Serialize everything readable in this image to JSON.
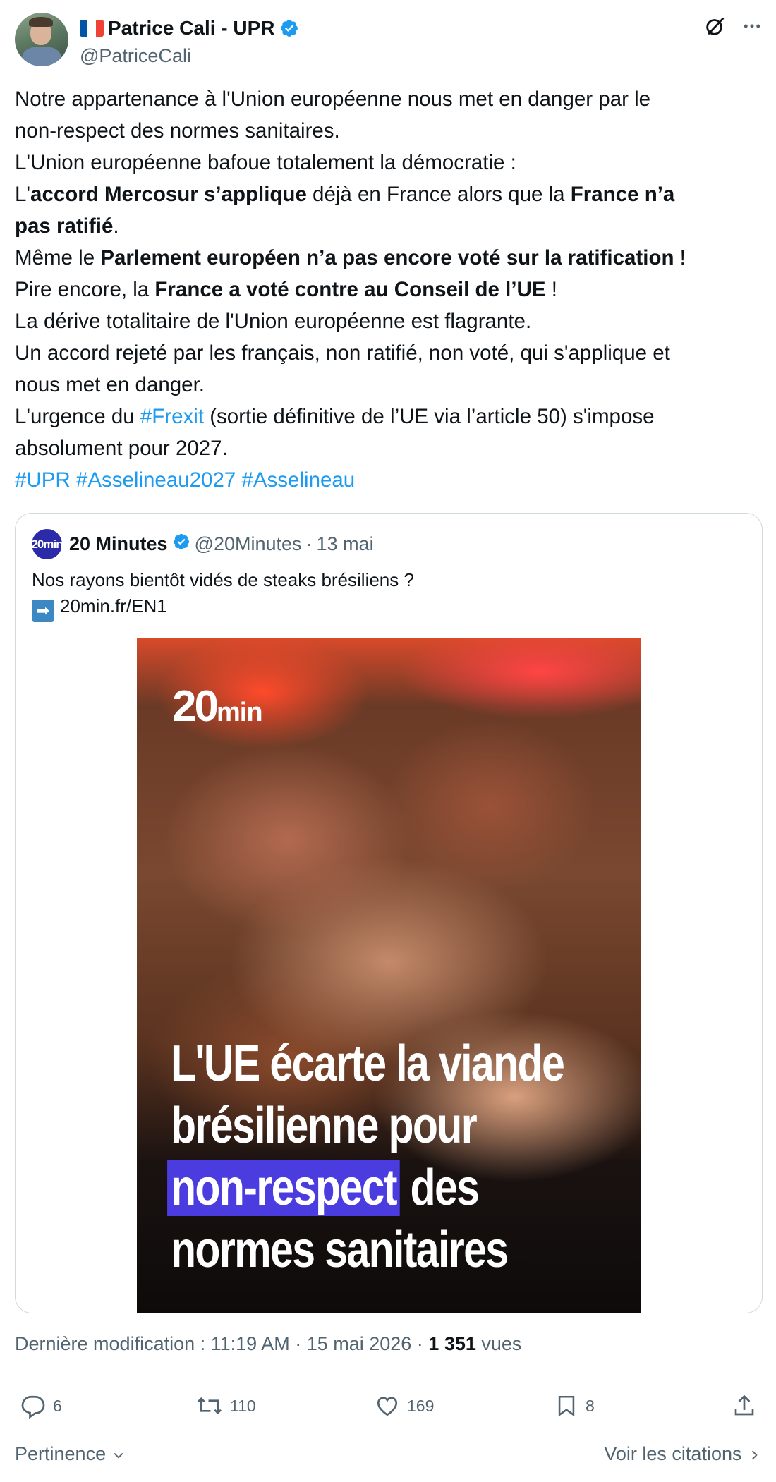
{
  "author": {
    "display_name": "Patrice Cali - UPR",
    "handle": "@PatriceCali",
    "flag_icon": "france-flag-icon",
    "verified_color": "#1d9bf0"
  },
  "tweet": {
    "lines": [
      {
        "t": "Notre appartenance à l'Union européenne nous met en danger par le"
      },
      {
        "t": "non-respect des normes sanitaires."
      },
      {
        "t": "L'Union européenne bafoue totalement la démocratie :"
      },
      {
        "a": "L'",
        "b": "accord Mercosur s’applique",
        "c": " déjà en France alors que la ",
        "d": "France n’a"
      },
      {
        "b": "pas ratifié",
        "c": "."
      },
      {
        "a": "Même le ",
        "b": "Parlement européen n’a pas encore voté sur la ratification",
        "c": " !"
      },
      {
        "a": "Pire encore, la ",
        "b": "France a voté contre au Conseil de l’UE",
        "c": " !"
      },
      {
        "t": "La dérive totalitaire de l'Union européenne est flagrante."
      },
      {
        "t": "Un accord rejeté par les français, non ratifié, non voté, qui s'applique et"
      },
      {
        "t": "nous met en danger."
      },
      {
        "a": "L'urgence du ",
        "tag": "#Frexit",
        "c": " (sortie définitive de l’UE via l’article 50) s'impose"
      },
      {
        "t": "absolument pour 2027."
      }
    ],
    "hashtags": [
      "#UPR",
      "#Asselineau2027",
      "#Asselineau"
    ]
  },
  "quote": {
    "logo_text": "20min",
    "name": "20 Minutes",
    "handle": "@20Minutes",
    "dot": "·",
    "date": "13 mai",
    "text_line1": "Nos rayons bientôt vidés de steaks brésiliens ?",
    "link": "20min.fr/EN1",
    "media": {
      "brand": "20",
      "brand_suffix": "min",
      "headline_line1": "L'UE écarte la viande",
      "headline_line2": "brésilienne pour",
      "headline_highlight": "non-respect",
      "headline_line3_rest": " des",
      "headline_line4": "normes sanitaires",
      "highlight_color": "#4b3ce0"
    }
  },
  "meta": {
    "edited_label": "Dernière modification : 11:19 AM · 15 mai 2026 · ",
    "views_count": "1 351",
    "views_label": " vues"
  },
  "actions": {
    "replies": "6",
    "reposts": "110",
    "likes": "169",
    "bookmarks": "8"
  },
  "footer": {
    "sort_label": "Pertinence",
    "quotes_label": "Voir les citations"
  },
  "colors": {
    "link": "#1d9bf0",
    "muted": "#536471",
    "text": "#0f1419"
  }
}
